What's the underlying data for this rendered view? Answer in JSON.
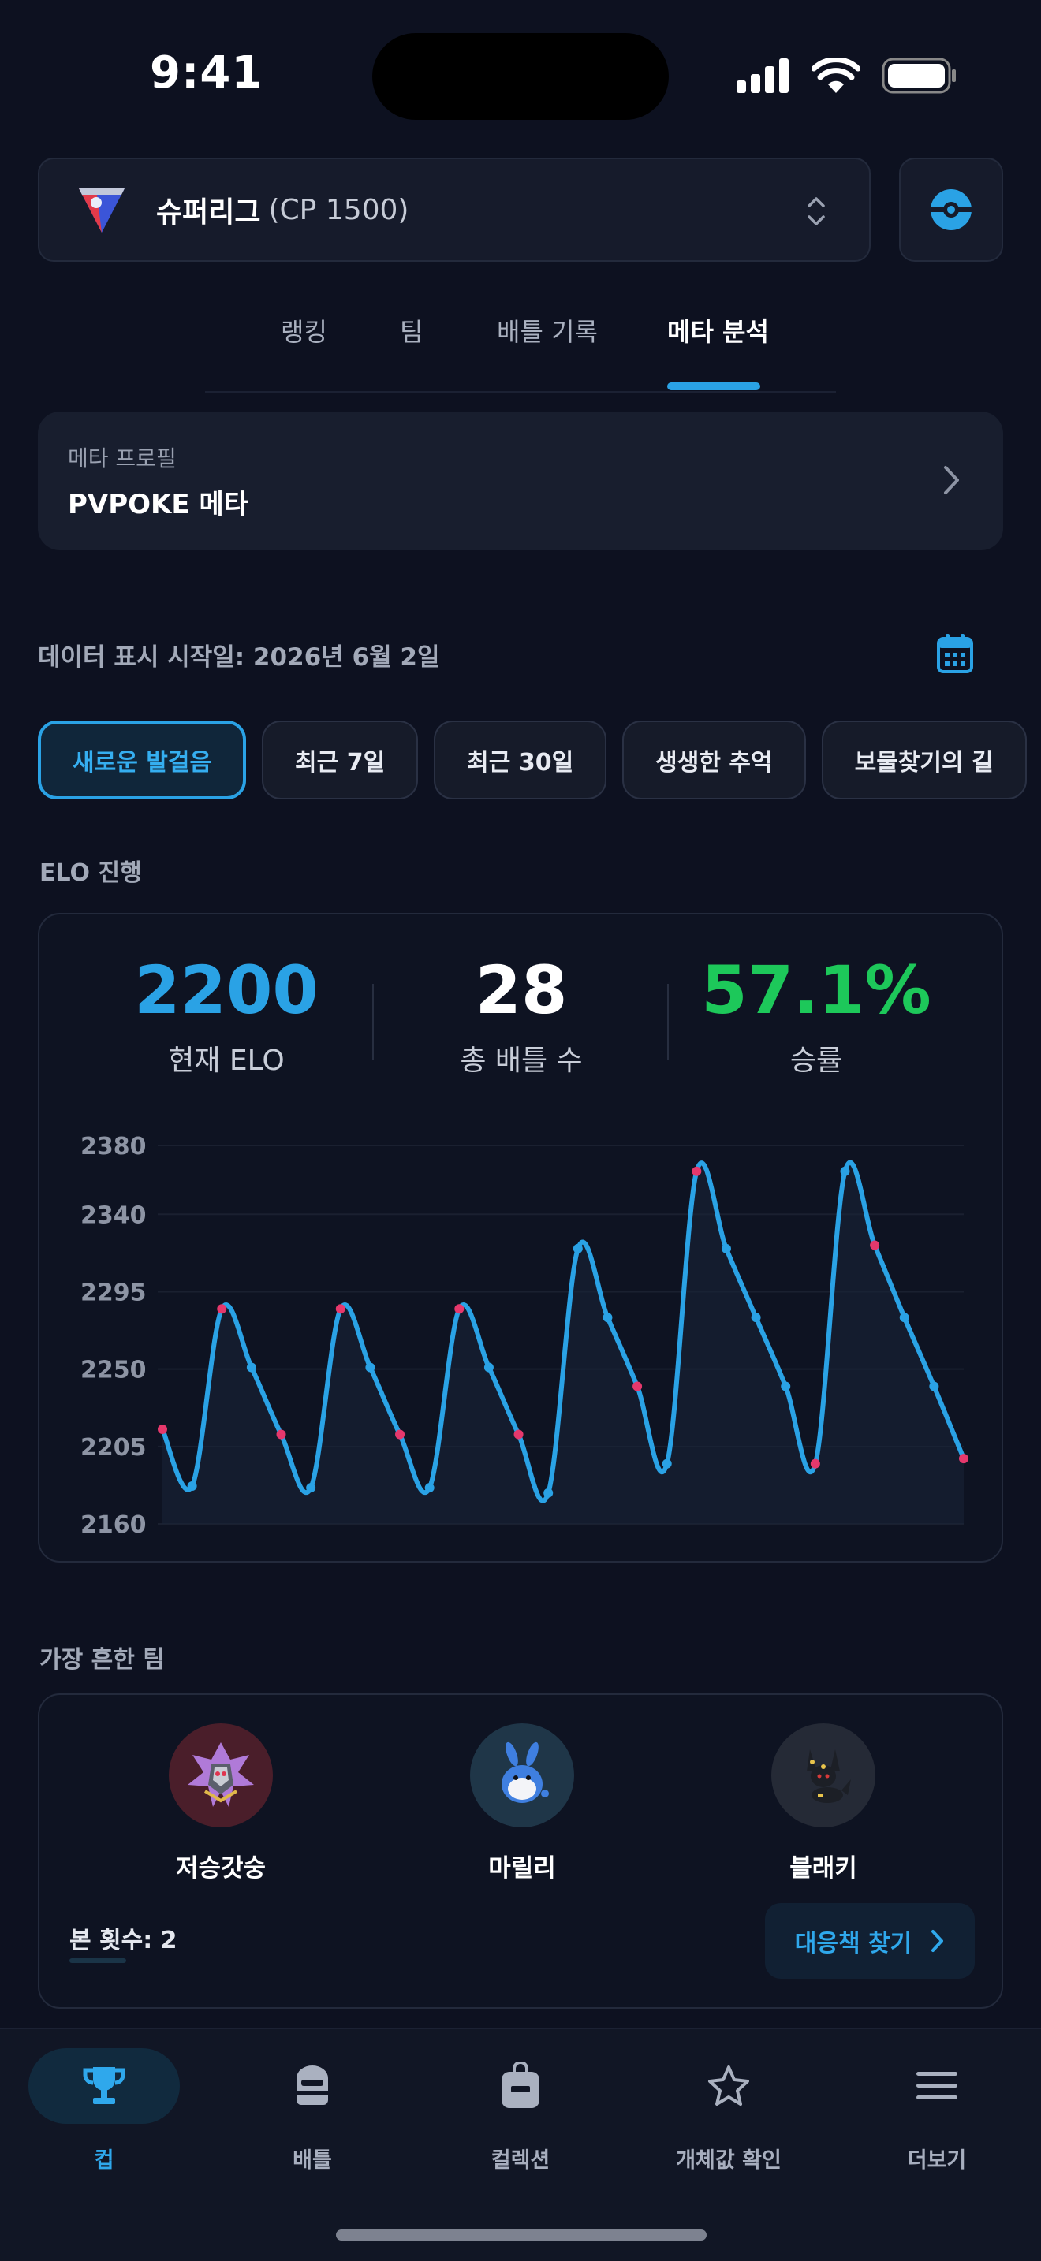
{
  "status_bar": {
    "time": "9:41"
  },
  "league": {
    "name": "슈퍼리그",
    "cp": "(CP 1500)"
  },
  "tabs": [
    {
      "label": "랭킹",
      "active": false
    },
    {
      "label": "팀",
      "active": false
    },
    {
      "label": "배틀 기록",
      "active": false
    },
    {
      "label": "메타 분석",
      "active": true
    }
  ],
  "meta_profile": {
    "label": "메타 프로필",
    "value": "PVPOKE 메타"
  },
  "date_label": "데이터 표시 시작일: 2026년 6월 2일",
  "chips": [
    {
      "label": "새로운 발걸음",
      "active": true
    },
    {
      "label": "최근 7일",
      "active": false
    },
    {
      "label": "최근 30일",
      "active": false
    },
    {
      "label": "생생한 추억",
      "active": false
    },
    {
      "label": "보물찾기의 길",
      "active": false
    }
  ],
  "elo_section_title": "ELO 진행",
  "stats": {
    "elo": {
      "value": "2200",
      "label": "현재 ELO",
      "color": "#2aa2e5"
    },
    "battles": {
      "value": "28",
      "label": "총 배틀 수",
      "color": "#ffffff"
    },
    "winrate": {
      "value": "57.1%",
      "label": "승률",
      "color": "#1dc85a"
    }
  },
  "chart_data": {
    "type": "line",
    "y_ticks": [
      "2380",
      "2340",
      "2295",
      "2250",
      "2205",
      "2160"
    ],
    "ylim": [
      2160,
      2380
    ],
    "series": [
      {
        "values": [
          2215,
          2182,
          2285,
          2251,
          2212,
          2181,
          2285,
          2251,
          2212,
          2181,
          2285,
          2251,
          2212,
          2178,
          2320,
          2280,
          2240,
          2195,
          2365,
          2320,
          2280,
          2240,
          2195,
          2365,
          2322,
          2280,
          2240,
          2198
        ],
        "colors": {
          "line": "#2aa2e5",
          "win_point": "#2aa2e5",
          "loss_point": "#e6386c"
        },
        "loss_indices": [
          0,
          2,
          4,
          6,
          8,
          10,
          12,
          16,
          18,
          22,
          24,
          27
        ]
      }
    ]
  },
  "team_section_title": "가장 흔한 팀",
  "team": {
    "members": [
      {
        "name": "저승갓숭",
        "icon": "giratina-icon",
        "bg": "#4a1e2a"
      },
      {
        "name": "마릴리",
        "icon": "azumarill-icon",
        "bg": "#1f3648"
      },
      {
        "name": "블래키",
        "icon": "umbreon-icon",
        "bg": "#252a36"
      }
    ],
    "seen": "본 횟수: 2",
    "counter_button": "대응책 찾기"
  },
  "nav": [
    {
      "label": "컵",
      "icon": "trophy-icon",
      "active": true
    },
    {
      "label": "배틀",
      "icon": "helmet-icon",
      "active": false
    },
    {
      "label": "컬렉션",
      "icon": "backpack-icon",
      "active": false
    },
    {
      "label": "개체값 확인",
      "icon": "star-icon",
      "active": false
    },
    {
      "label": "더보기",
      "icon": "menu-icon",
      "active": false
    }
  ]
}
